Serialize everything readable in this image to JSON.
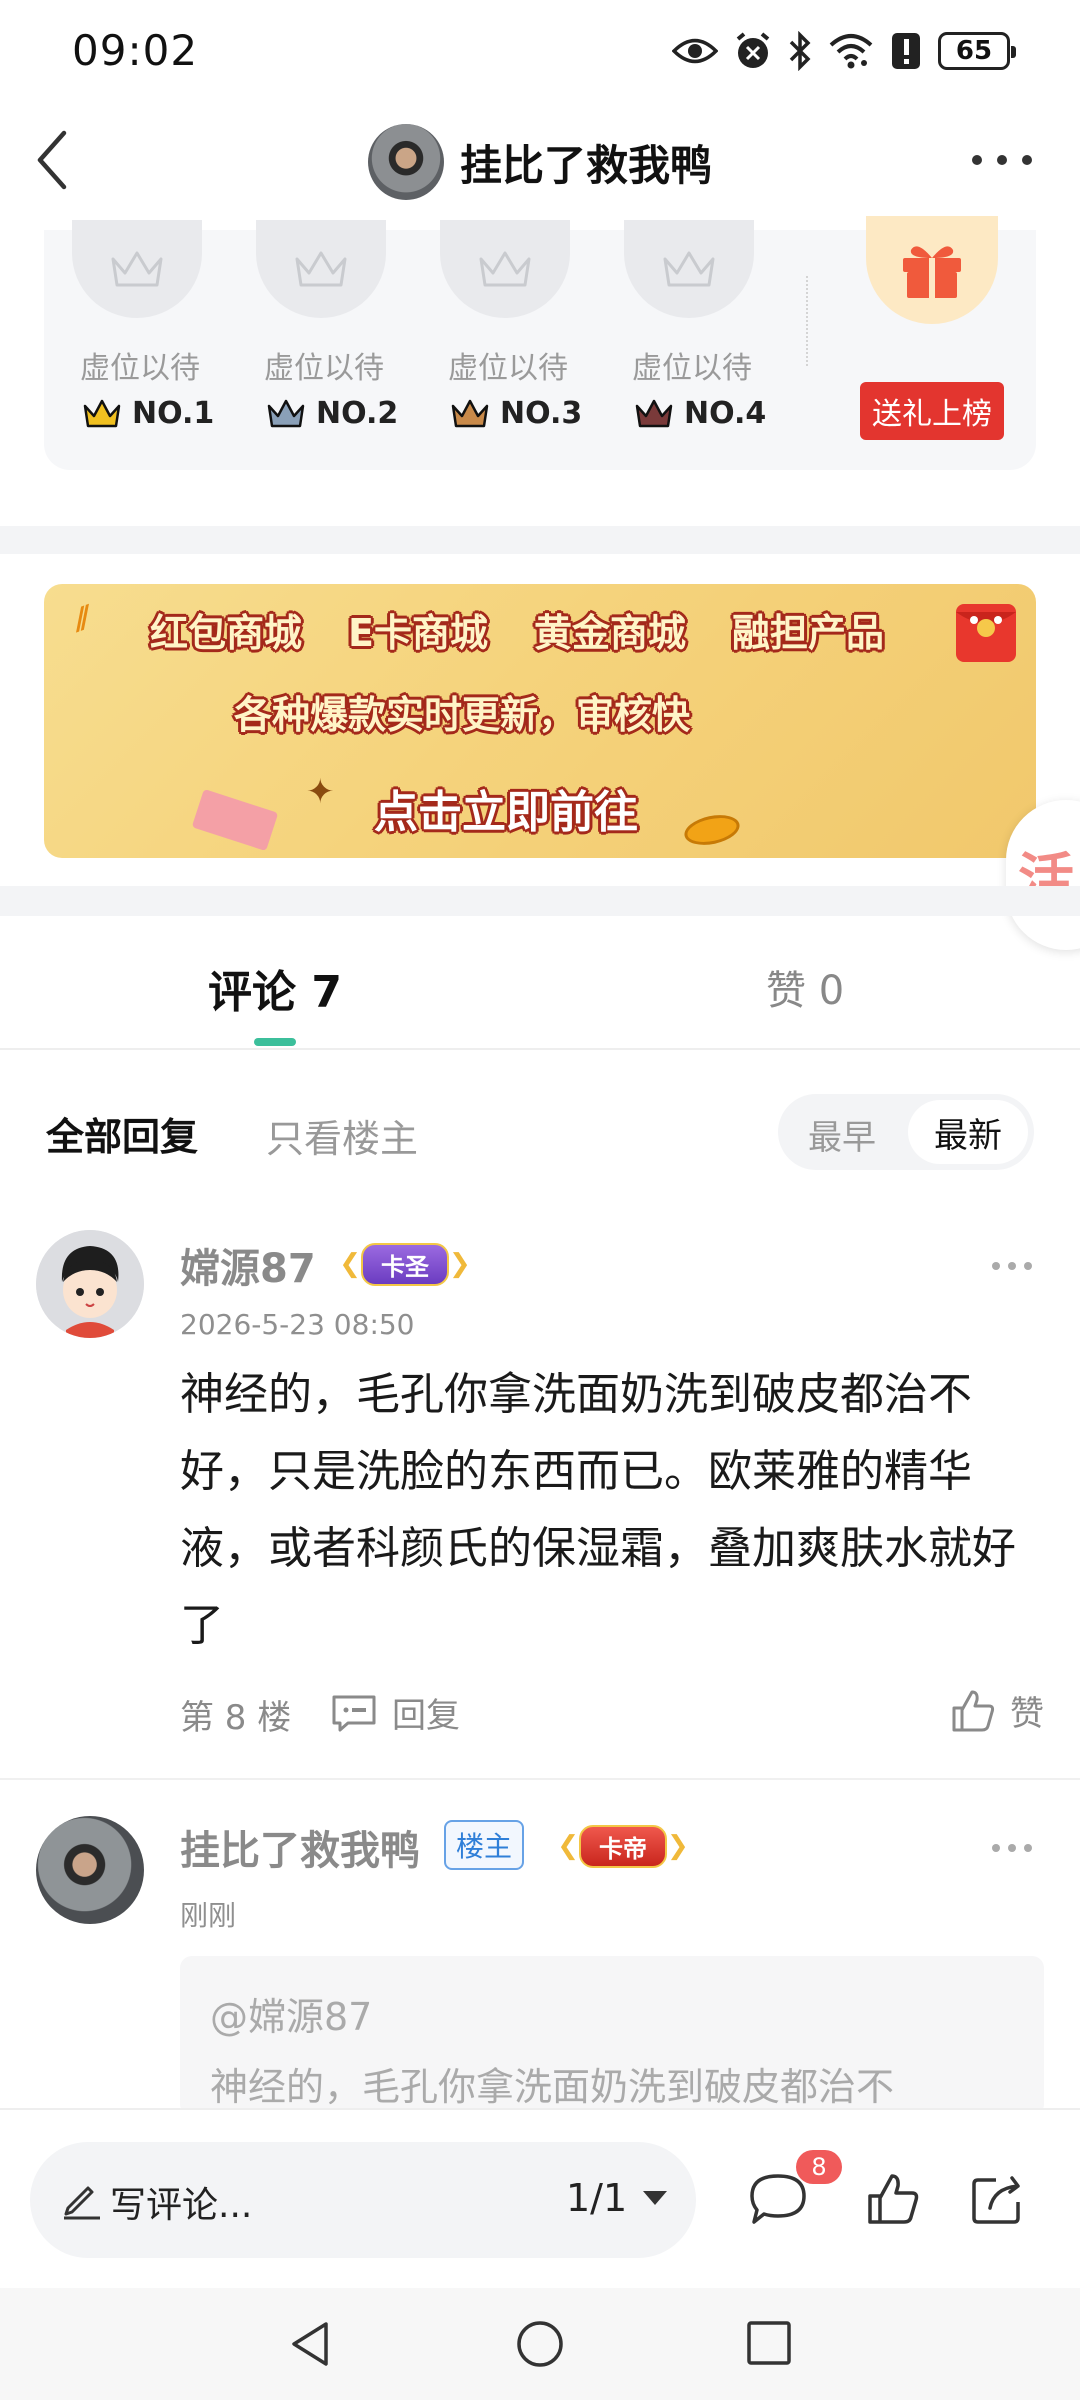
{
  "status_bar": {
    "time": "09:02",
    "battery": "65"
  },
  "header": {
    "title": "挂比了救我鸭"
  },
  "ranking": {
    "slots": [
      {
        "label": "虚位以待",
        "rank": "NO.1",
        "crown_color": "#f0c020"
      },
      {
        "label": "虚位以待",
        "rank": "NO.2",
        "crown_color": "#8aa0b8"
      },
      {
        "label": "虚位以待",
        "rank": "NO.3",
        "crown_color": "#c98a4a"
      },
      {
        "label": "虚位以待",
        "rank": "NO.4",
        "crown_color": "#7a3a3a"
      }
    ],
    "gift_button": "送礼上榜"
  },
  "banner": {
    "items": [
      "红包商城",
      "E卡商城",
      "黄金商城",
      "融担产品"
    ],
    "subtitle": "各种爆款实时更新，审核快",
    "cta": "点击立即前往"
  },
  "tabs": {
    "comments": "评论 7",
    "likes": "赞 0",
    "accent": "#3cbf9b"
  },
  "filters": {
    "all": "全部回复",
    "op_only": "只看楼主",
    "sort_earliest": "最早",
    "sort_latest": "最新"
  },
  "comments": [
    {
      "user": "嫦源87",
      "level_badge": "卡圣",
      "time": "2026-5-23 08:50",
      "text": "神经的，毛孔你拿洗面奶洗到破皮都治不好，只是洗脸的东西而已。欧莱雅的精华液，或者科颜氏的保湿霜，叠加爽肤水就好了",
      "floor": "第 8 楼",
      "reply_label": "回复",
      "like_label": "赞"
    },
    {
      "user": "挂比了救我鸭",
      "owner_tag": "楼主",
      "level_badge": "卡帝",
      "time": "刚刚",
      "quote_user": "@嫦源87",
      "quote_text": "神经的，毛孔你拿洗面奶洗到破皮都治不"
    }
  ],
  "bottom_bar": {
    "placeholder": "写评论...",
    "page": "1/1",
    "comment_badge": "8"
  },
  "float_badge": "活"
}
